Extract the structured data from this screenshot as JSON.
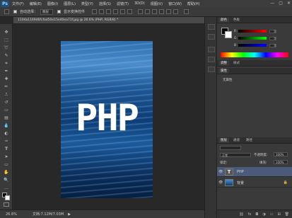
{
  "app": {
    "logo": "Ps"
  },
  "menu": [
    "文件(F)",
    "编辑(E)",
    "图像(I)",
    "图层(L)",
    "类型(Y)",
    "选择(S)",
    "滤镜(T)",
    "3D(D)",
    "视图(V)",
    "窗口(W)",
    "帮助(H)"
  ],
  "window_controls": [
    "—",
    "▢",
    "✕"
  ],
  "options_bar": {
    "auto_select": "自动选择：",
    "group_value": "图层",
    "show_transform": "显示变换控件"
  },
  "document": {
    "tab_title": "1104a1169d6fcfad50e15e40ea71f.jpg @ 26.6% (PHP, RGB/8) *",
    "canvas_text": "PHP"
  },
  "status": {
    "zoom": "26.6%",
    "doc_info": "文档:7.12M/7.03M"
  },
  "color_panel": {
    "tabs": [
      "颜色",
      "色板"
    ],
    "channels": [
      {
        "label": "R",
        "value": "0"
      },
      {
        "label": "G",
        "value": "0"
      },
      {
        "label": "B",
        "value": "0"
      }
    ]
  },
  "adjust_panel": {
    "tabs": [
      "调整",
      "样式"
    ],
    "tabs2": [
      "属性"
    ],
    "title": "无属性"
  },
  "layers_panel": {
    "tabs": [
      "图层",
      "通道",
      "路径"
    ],
    "blend_mode": "正常",
    "opacity_label": "不透明度:",
    "opacity_value": "100%",
    "lock_label": "锁定:",
    "fill_label": "填充:",
    "fill_value": "100%",
    "layers": [
      {
        "name": "PHP",
        "type": "text"
      },
      {
        "name": "背景",
        "type": "image"
      }
    ]
  },
  "colors": {
    "accent": "#1d4f7f",
    "selected_layer": "#4a5a78"
  }
}
